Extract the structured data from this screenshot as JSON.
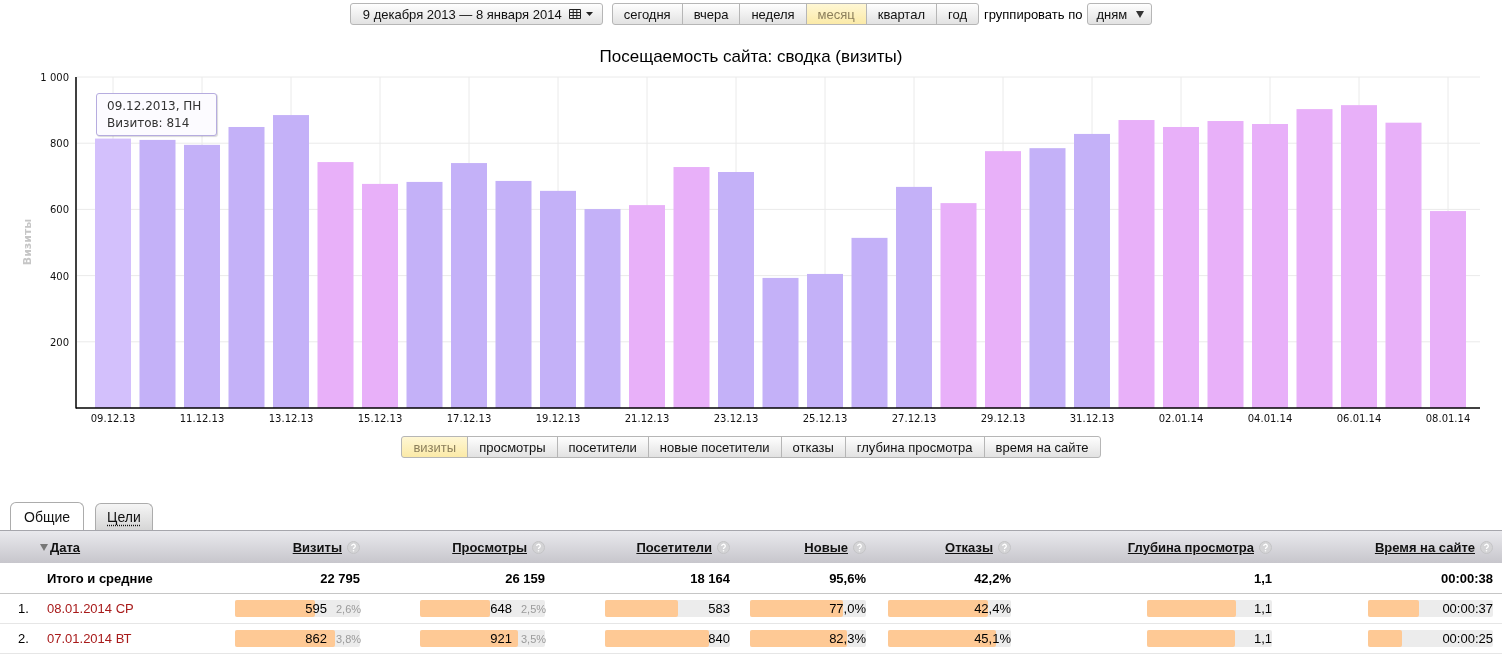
{
  "toolbar": {
    "date_range": {
      "label": "9 декабря 2013 — 8 января 2014"
    },
    "periods": [
      {
        "label": "сегодня",
        "selected": false
      },
      {
        "label": "вчера",
        "selected": false
      },
      {
        "label": "неделя",
        "selected": false
      },
      {
        "label": "месяц",
        "selected": true
      },
      {
        "label": "квартал",
        "selected": false
      },
      {
        "label": "год",
        "selected": false
      }
    ],
    "group_label": "группировать по",
    "group_select": {
      "value": "дням"
    }
  },
  "chart": {
    "chart_data": {
      "type": "bar",
      "title": "Посещаемость сайта: сводка (визиты)",
      "ylabel": "Визиты",
      "categories": [
        "09.12.13",
        null,
        "11.12.13",
        null,
        "13.12.13",
        null,
        "15.12.13",
        null,
        "17.12.13",
        null,
        "19.12.13",
        null,
        "21.12.13",
        null,
        "23.12.13",
        null,
        "25.12.13",
        null,
        "27.12.13",
        null,
        "29.12.13",
        null,
        "31.12.13",
        null,
        "02.01.14",
        null,
        "04.01.14",
        null,
        "06.01.14",
        null,
        "08.01.14"
      ],
      "values": [
        814,
        810,
        795,
        849,
        885,
        743,
        677,
        683,
        740,
        686,
        656,
        601,
        613,
        728,
        713,
        393,
        405,
        514,
        668,
        619,
        776,
        785,
        828,
        870,
        849,
        867,
        858,
        903,
        915,
        862,
        595
      ],
      "ylim": [
        0,
        1000
      ],
      "yticks": [
        200,
        400,
        600,
        800,
        {
          "value": 1000,
          "label": "1 000"
        }
      ],
      "grid": true
    },
    "bars": [
      {
        "holiday": false,
        "highlighted": true
      },
      {
        "holiday": false,
        "highlighted": false
      },
      {
        "holiday": false,
        "highlighted": false
      },
      {
        "holiday": false,
        "highlighted": false
      },
      {
        "holiday": false,
        "highlighted": false
      },
      {
        "holiday": true,
        "highlighted": false
      },
      {
        "holiday": true,
        "highlighted": false
      },
      {
        "holiday": false,
        "highlighted": false
      },
      {
        "holiday": false,
        "highlighted": false
      },
      {
        "holiday": false,
        "highlighted": false
      },
      {
        "holiday": false,
        "highlighted": false
      },
      {
        "holiday": false,
        "highlighted": false
      },
      {
        "holiday": true,
        "highlighted": false
      },
      {
        "holiday": true,
        "highlighted": false
      },
      {
        "holiday": false,
        "highlighted": false
      },
      {
        "holiday": false,
        "highlighted": false
      },
      {
        "holiday": false,
        "highlighted": false
      },
      {
        "holiday": false,
        "highlighted": false
      },
      {
        "holiday": false,
        "highlighted": false
      },
      {
        "holiday": true,
        "highlighted": false
      },
      {
        "holiday": true,
        "highlighted": false
      },
      {
        "holiday": false,
        "highlighted": false
      },
      {
        "holiday": false,
        "highlighted": false
      },
      {
        "holiday": true,
        "highlighted": false
      },
      {
        "holiday": true,
        "highlighted": false
      },
      {
        "holiday": true,
        "highlighted": false
      },
      {
        "holiday": true,
        "highlighted": false
      },
      {
        "holiday": true,
        "highlighted": false
      },
      {
        "holiday": true,
        "highlighted": false
      },
      {
        "holiday": true,
        "highlighted": false
      },
      {
        "holiday": true,
        "highlighted": false
      }
    ],
    "tooltip": {
      "title": "09.12.2013, ПН",
      "text": "Визитов: 814"
    }
  },
  "metric_tabs": [
    {
      "label": "визиты",
      "selected": true
    },
    {
      "label": "просмотры",
      "selected": false
    },
    {
      "label": "посетители",
      "selected": false
    },
    {
      "label": "новые посетители",
      "selected": false
    },
    {
      "label": "отказы",
      "selected": false
    },
    {
      "label": "глубина просмотра",
      "selected": false
    },
    {
      "label": "время на сайте",
      "selected": false
    }
  ],
  "report_tabs": [
    {
      "label": "Общие",
      "selected": true
    },
    {
      "label": "Цели",
      "selected": false
    }
  ],
  "table": {
    "columns": [
      {
        "label": "Дата",
        "sorted": true,
        "help": false
      },
      {
        "label": "Визиты",
        "sorted": false,
        "help": true
      },
      {
        "label": "Просмотры",
        "sorted": false,
        "help": true
      },
      {
        "label": "Посетители",
        "sorted": false,
        "help": true
      },
      {
        "label": "Новые",
        "sorted": false,
        "help": true
      },
      {
        "label": "Отказы",
        "sorted": false,
        "help": true
      },
      {
        "label": "Глубина просмотра",
        "sorted": false,
        "help": true
      },
      {
        "label": "Время на сайте",
        "sorted": false,
        "help": true
      }
    ],
    "totals": {
      "cells": [
        "Итого и средние",
        "22 795",
        "26 159",
        "18 164",
        "95,6%",
        "42,2%",
        "1,1",
        "00:00:38"
      ]
    },
    "rows": [
      {
        "number": "1.",
        "cells": [
          {
            "kind": "date",
            "value": "08.01.2014 СР",
            "holiday": true
          },
          {
            "kind": "bar",
            "value": "595",
            "share": "2,6%",
            "level": 0.64
          },
          {
            "kind": "bar",
            "value": "648",
            "share": "2,5%",
            "level": 0.56
          },
          {
            "kind": "bar",
            "value": "583",
            "level": 0.58
          },
          {
            "kind": "bar",
            "value": "77,0%",
            "level": 0.8
          },
          {
            "kind": "bar",
            "value": "42,4%",
            "level": 0.81
          },
          {
            "kind": "bar",
            "value": "1,1",
            "level": 0.71
          },
          {
            "kind": "bar",
            "value": "00:00:37",
            "level": 0.41
          }
        ]
      },
      {
        "number": "2.",
        "cells": [
          {
            "kind": "date",
            "value": "07.01.2014 ВТ",
            "holiday": true
          },
          {
            "kind": "bar",
            "value": "862",
            "share": "3,8%",
            "level": 0.8
          },
          {
            "kind": "bar",
            "value": "921",
            "share": "3,5%",
            "level": 0.78
          },
          {
            "kind": "bar",
            "value": "840",
            "level": 0.83
          },
          {
            "kind": "bar",
            "value": "82,3%",
            "level": 0.84
          },
          {
            "kind": "bar",
            "value": "45,1%",
            "level": 0.88
          },
          {
            "kind": "bar",
            "value": "1,1",
            "level": 0.7
          },
          {
            "kind": "bar",
            "value": "00:00:25",
            "level": 0.27
          }
        ]
      }
    ]
  }
}
